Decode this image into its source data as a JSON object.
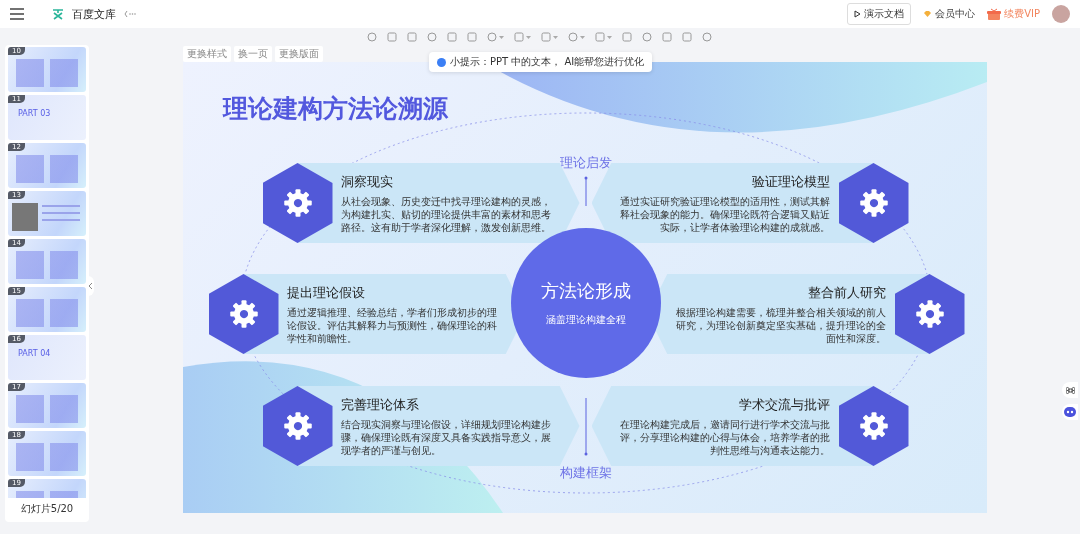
{
  "app": {
    "title": "百度文库"
  },
  "header_buttons": [
    {
      "kind": "present",
      "label": "演示文档"
    },
    {
      "kind": "member",
      "label": "会员中心"
    },
    {
      "kind": "vip",
      "label": "续费VIP"
    }
  ],
  "slide_actions": [
    "更换样式",
    "换一页",
    "更换版面"
  ],
  "tip": "小提示：PPT 中的文本， AI能帮您进行优化",
  "thumbnails": [
    {
      "number": "10",
      "kind": "content"
    },
    {
      "number": "11",
      "kind": "section",
      "part": "PART 03"
    },
    {
      "number": "12",
      "kind": "content"
    },
    {
      "number": "13",
      "kind": "photo"
    },
    {
      "number": "14",
      "kind": "content"
    },
    {
      "number": "15",
      "kind": "content"
    },
    {
      "number": "16",
      "kind": "section",
      "part": "PART 04"
    },
    {
      "number": "17",
      "kind": "content"
    },
    {
      "number": "18",
      "kind": "content"
    },
    {
      "number": "19",
      "kind": "content"
    }
  ],
  "slide_counter": "幻灯片5/20",
  "slide": {
    "title": "理论建构方法论溯源",
    "top_label": "理论启发",
    "bottom_label": "构建框架",
    "center": {
      "title": "方法论形成",
      "subtitle": "涵盖理论构建全程"
    },
    "steps": [
      {
        "kind": "left",
        "title": "洞察现实",
        "text": "从社会现象、历史变迁中找寻理论建构的灵感，为构建扎实、贴切的理论提供丰富的素材和思考路径。这有助于学者深化理解，激发创新思维。"
      },
      {
        "kind": "right",
        "title": "验证理论模型",
        "text": "通过实证研究验证理论模型的适用性，测试其解释社会现象的能力。确保理论既符合逻辑又贴近实际，让学者体验理论构建的成就感。"
      },
      {
        "kind": "left",
        "title": "提出理论假设",
        "text": "通过逻辑推理、经验总结，学者们形成初步的理论假设。评估其解释力与预测性，确保理论的科学性和前瞻性。"
      },
      {
        "kind": "right",
        "title": "整合前人研究",
        "text": "根据理论构建需要，梳理并整合相关领域的前人研究，为理论创新奠定坚实基础，提升理论的全面性和深度。"
      },
      {
        "kind": "left",
        "title": "完善理论体系",
        "text": "结合现实洞察与理论假设，详细规划理论构建步骤，确保理论既有深度又具备实践指导意义，展现学者的严谨与创见。"
      },
      {
        "kind": "right",
        "title": "学术交流与批评",
        "text": "在理论构建完成后，邀请同行进行学术交流与批评，分享理论构建的心得与体会，培养学者的批判性思维与沟通表达能力。"
      }
    ]
  }
}
